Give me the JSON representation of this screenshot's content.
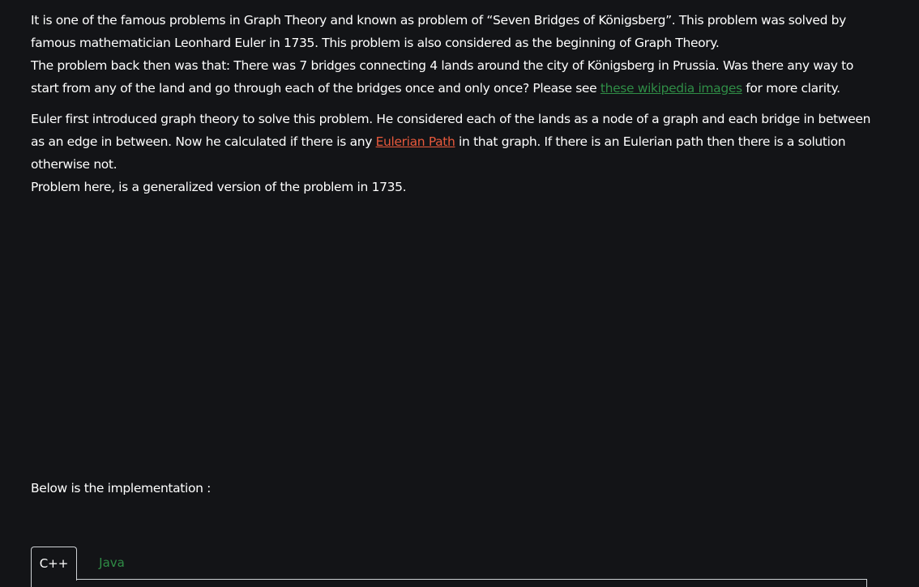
{
  "article": {
    "p1": "It is one of the famous problems in Graph Theory and known as problem of “Seven Bridges of Königsberg”. This problem was solved by famous mathematician Leonhard Euler in 1735. This problem is also considered as the beginning of Graph Theory.",
    "p2_before": "The problem back then was that: There was 7 bridges connecting 4 lands around the city of Königsberg in Prussia. Was there any way to start from any of the land and go through each of the bridges once and only once? Please see ",
    "p2_link": "these wikipedia images",
    "p2_after": " for more clarity.",
    "p3_before": "Euler first introduced graph theory to solve this problem. He considered each of the lands as a node of a graph and each bridge in between as an edge in between. Now he calculated if there is any ",
    "p3_link": "Eulerian Path",
    "p3_after": " in that graph. If there is an Eulerian path then there is a solution otherwise not.",
    "p4": "Problem here, is a generalized version of the problem in 1735."
  },
  "implementation_label": "Below is the implementation :",
  "tabs": [
    {
      "label": "C++",
      "active": true
    },
    {
      "label": "Java",
      "active": false
    }
  ],
  "colors": {
    "background": "#131417",
    "text": "#ffffff",
    "link_green": "#2f8d46",
    "link_orange": "#e8593c"
  }
}
